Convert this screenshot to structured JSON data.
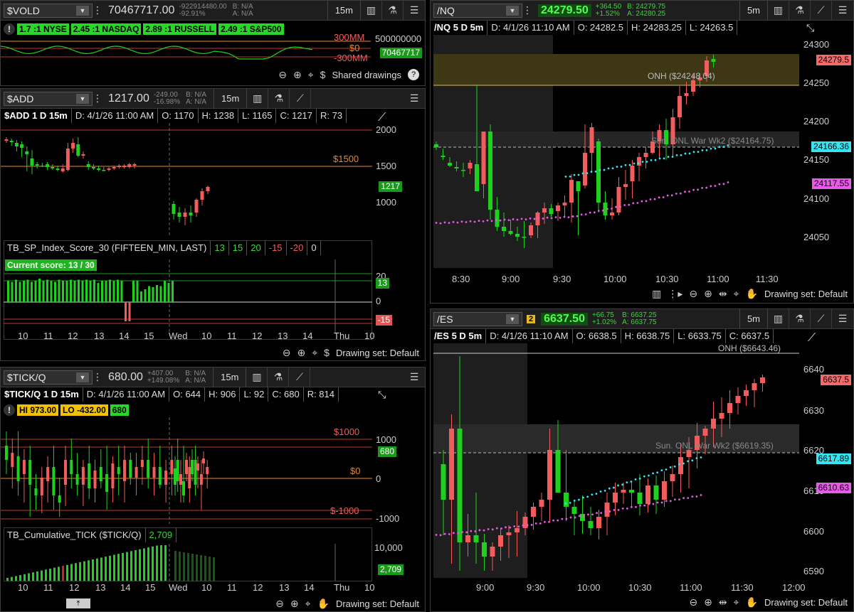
{
  "vold": {
    "symbol": "$VOLD",
    "price": "70467717.00",
    "change1": "-922914480.00",
    "change2": "-92.91%",
    "bid": "B: N/A",
    "ask": "A: N/A",
    "timeframe": "15m",
    "breadth": [
      "1.7 :1 NYSE",
      "2.45 :1 NASDAQ",
      "2.89 :1 RUSSELL",
      "2.49 :1 S&P500"
    ],
    "levels": [
      "300MM",
      "$0",
      "-300MM"
    ],
    "axis_top": "500000000",
    "last_tag": "70467717",
    "shared_drawings": "Shared drawings"
  },
  "add": {
    "symbol": "$ADD",
    "price": "1217.00",
    "change1": "-249.00",
    "change2": "-16.98%",
    "bid": "B: N/A",
    "ask": "A: N/A",
    "timeframe": "15m",
    "title": "$ADD 1 D 15m",
    "date": "D: 4/1/26 11:00 AM",
    "open": "O: 1170",
    "high": "H: 1238",
    "low": "L: 1165",
    "close": "C: 1217",
    "range": "R: 73",
    "yaxis": [
      "2000",
      "1500",
      "1000"
    ],
    "level1500": "$1500",
    "last_tag": "1217",
    "study_name": "TB_SP_Index_Score_30 (FIFTEEN_MIN, LAST)",
    "study_vals": [
      "13",
      "15",
      "20",
      "-15",
      "-20",
      "0"
    ],
    "current_score": "Current score: 13 / 30",
    "score_axis": [
      "20",
      "0"
    ],
    "score_tags": [
      "13",
      "-15"
    ],
    "xaxis": [
      "10",
      "11",
      "12",
      "13",
      "14",
      "15",
      "Wed",
      "10",
      "11",
      "12",
      "13",
      "14",
      "Thu",
      "10"
    ],
    "drawing_set": "Drawing set: Default"
  },
  "tick": {
    "symbol": "$TICK/Q",
    "price": "680.00",
    "change1": "+407.00",
    "change2": "+149.08%",
    "bid": "B: N/A",
    "ask": "A: N/A",
    "timeframe": "15m",
    "title": "$TICK/Q 1 D 15m",
    "date": "D: 4/1/26 11:00 AM",
    "open": "O: 644",
    "high": "H: 906",
    "low": "L: 92",
    "close": "C: 680",
    "range": "R: 814",
    "hi": "HI 973.00",
    "lo": "LO -432.00",
    "last_badge": "680",
    "yaxis": [
      "1000",
      "0",
      "-1000"
    ],
    "levels": [
      "$1000",
      "$0",
      "$-1000"
    ],
    "last_tag": "680",
    "study_name": "TB_Cumulative_TICK ($TICK/Q)",
    "study_val": "2,709",
    "study_axis": "10,000",
    "study_tag": "2,709",
    "xaxis": [
      "10",
      "11",
      "12",
      "13",
      "14",
      "15",
      "Wed",
      "10",
      "11",
      "12",
      "13",
      "14",
      "Thu",
      "10"
    ],
    "drawing_set": "Drawing set: Default"
  },
  "nq": {
    "symbol": "/NQ",
    "price": "24279.50",
    "change1": "+364.50",
    "change2": "+1.52%",
    "bid": "B: 24279.75",
    "ask": "A: 24280.25",
    "timeframe": "5m",
    "title": "/NQ 5 D 5m",
    "date": "D: 4/1/26 11:10 AM",
    "open": "O: 24282.5",
    "high": "H: 24283.25",
    "low": "L: 24263.5",
    "yaxis": [
      "24300",
      "24250",
      "24200",
      "24150",
      "24100",
      "24050"
    ],
    "onh": "ONH ($24248.04)",
    "sun": "Sun. ONL War Wk2 ($24164.75)",
    "tags": [
      "24279.5",
      "24166.36",
      "24117.55"
    ],
    "xaxis": [
      "8:30",
      "9:00",
      "9:30",
      "10:00",
      "10:30",
      "11:00",
      "11:30"
    ],
    "drawing_set": "Drawing set: Default"
  },
  "es": {
    "symbol": "/ES",
    "badge": "2",
    "price": "6637.50",
    "change1": "+66.75",
    "change2": "+1.02%",
    "bid": "B: 6637.25",
    "ask": "A: 6637.75",
    "timeframe": "5m",
    "title": "/ES 5 D 5m",
    "date": "D: 4/1/26 11:10 AM",
    "open": "O: 6638.5",
    "high": "H: 6638.75",
    "low": "L: 6633.75",
    "close": "C: 6637.5",
    "yaxis": [
      "6640",
      "6630",
      "6620",
      "6610",
      "6600",
      "6590"
    ],
    "onh": "ONH ($6643.46)",
    "sun": "Sun. ONL War Wk2 ($6619.35)",
    "tags": [
      "6637.5",
      "6617.89",
      "6610.63"
    ],
    "xaxis": [
      "9:00",
      "9:30",
      "10:00",
      "10:30",
      "11:00",
      "11:30",
      "12:00"
    ],
    "drawing_set": "Drawing set: Default"
  },
  "colors": {
    "up": "#1fd11f",
    "down": "#f25c5c",
    "cyan": "#35e5f2",
    "magenta": "#e85ae8",
    "orange": "#e8862b"
  }
}
